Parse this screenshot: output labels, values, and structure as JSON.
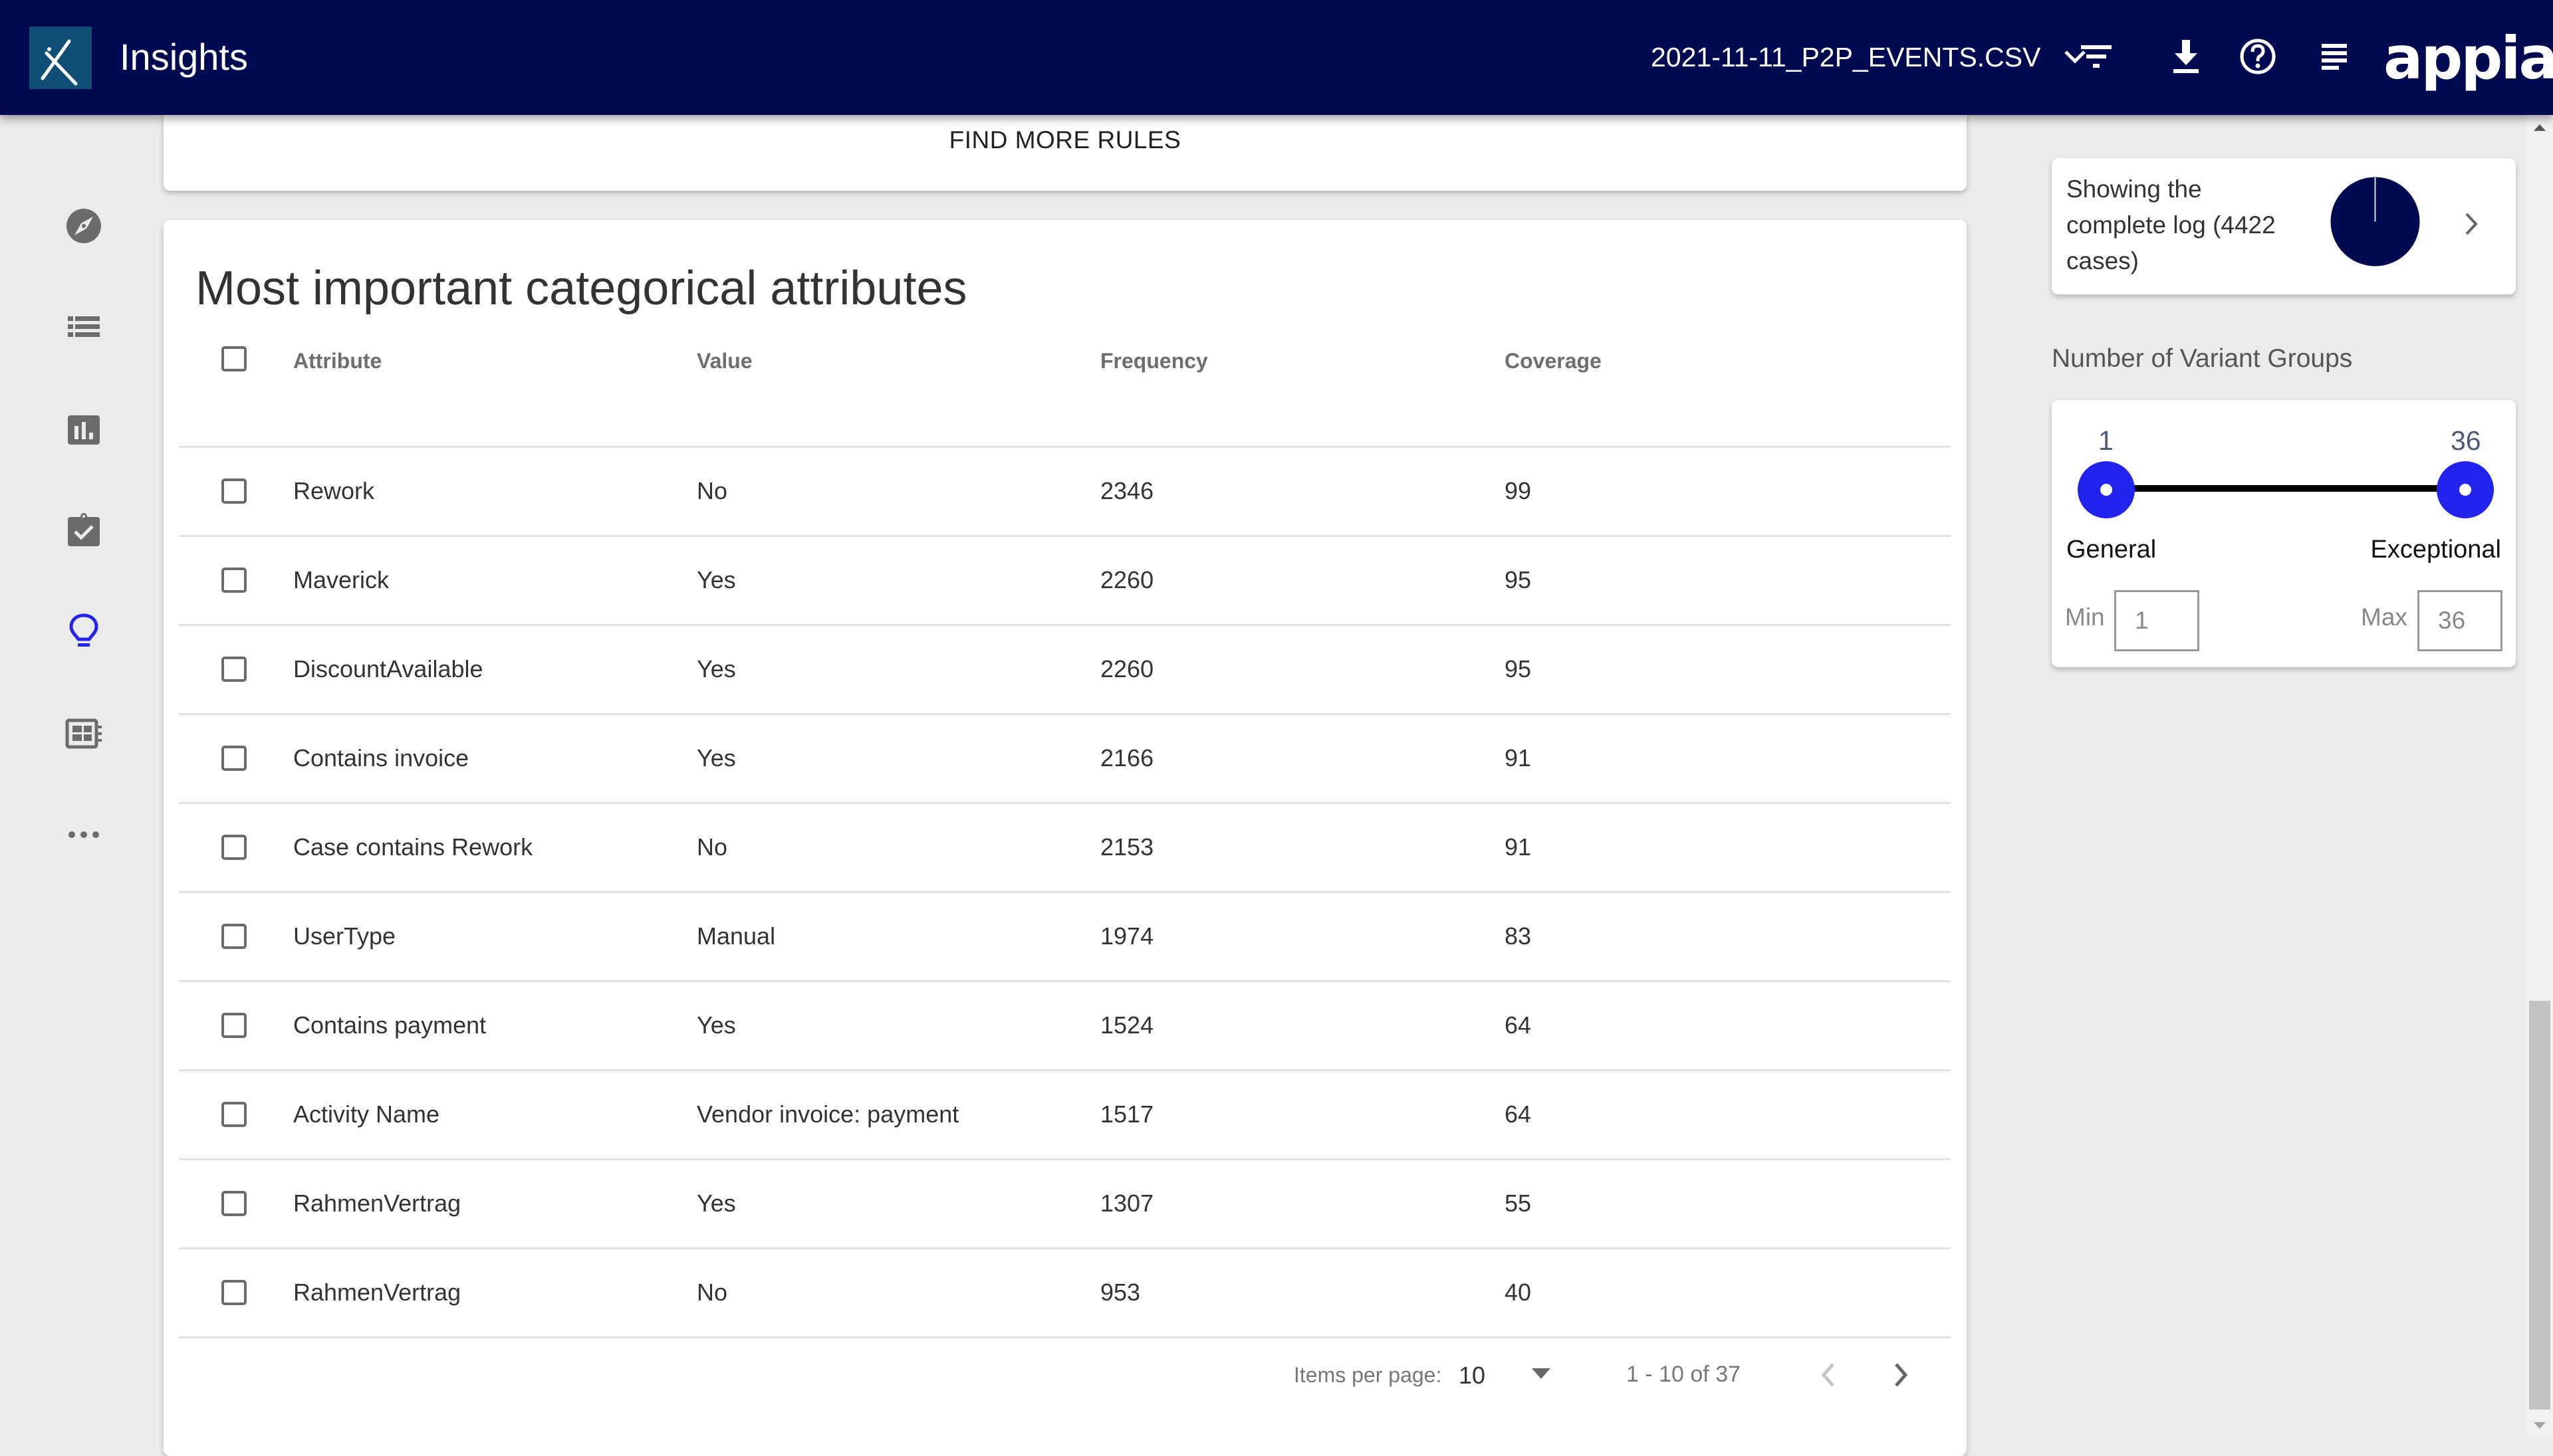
{
  "header": {
    "app_title": "Insights",
    "file_name": "2021-11-11_P2P_EVENTS.CSV",
    "brand": "appian",
    "icons": [
      "insights-logo-icon",
      "chevron-down-icon",
      "filter-icon",
      "download-icon",
      "help-icon",
      "notes-icon"
    ]
  },
  "sidebar": {
    "items": [
      {
        "icon": "compass-icon",
        "active": false
      },
      {
        "icon": "list-icon",
        "active": false
      },
      {
        "icon": "bar-chart-icon",
        "active": false
      },
      {
        "icon": "clipboard-check-icon",
        "active": false
      },
      {
        "icon": "lightbulb-icon",
        "active": true
      },
      {
        "icon": "dashboard-icon",
        "active": false
      },
      {
        "icon": "more-icon",
        "active": false
      }
    ],
    "active_color": "#2323ee"
  },
  "rules_card": {
    "find_more_label": "FIND MORE RULES"
  },
  "attributes": {
    "title": "Most important categorical attributes",
    "columns": [
      "Attribute",
      "Value",
      "Frequency",
      "Coverage"
    ],
    "rows": [
      {
        "attribute": "Rework",
        "value": "No",
        "frequency": "2346",
        "coverage": "99"
      },
      {
        "attribute": "Maverick",
        "value": "Yes",
        "frequency": "2260",
        "coverage": "95"
      },
      {
        "attribute": "DiscountAvailable",
        "value": "Yes",
        "frequency": "2260",
        "coverage": "95"
      },
      {
        "attribute": "Contains invoice",
        "value": "Yes",
        "frequency": "2166",
        "coverage": "91"
      },
      {
        "attribute": "Case contains Rework",
        "value": "No",
        "frequency": "2153",
        "coverage": "91"
      },
      {
        "attribute": "UserType",
        "value": "Manual",
        "frequency": "1974",
        "coverage": "83"
      },
      {
        "attribute": "Contains payment",
        "value": "Yes",
        "frequency": "1524",
        "coverage": "64"
      },
      {
        "attribute": "Activity Name",
        "value": "Vendor invoice: payment",
        "frequency": "1517",
        "coverage": "64"
      },
      {
        "attribute": "RahmenVertrag",
        "value": "Yes",
        "frequency": "1307",
        "coverage": "55"
      },
      {
        "attribute": "RahmenVertrag",
        "value": "No",
        "frequency": "953",
        "coverage": "40"
      }
    ],
    "pagination": {
      "items_per_page_label": "Items per page:",
      "items_per_page": "10",
      "range": "1 - 10 of 37"
    }
  },
  "right_panel": {
    "log_summary": "Showing the complete log (4422 cases)",
    "log_fraction_shown": 1.0,
    "variant_groups_label": "Number of Variant Groups",
    "slider": {
      "min_value": "1",
      "max_value": "36",
      "range_min": 1,
      "range_max": 36,
      "left_caption": "General",
      "right_caption": "Exceptional",
      "min_label": "Min",
      "max_label": "Max",
      "min_input": "1",
      "max_input": "36",
      "thumb_color": "#2323ee"
    }
  },
  "colors": {
    "header_bg": "#000a50",
    "pie_fill": "#000a50"
  }
}
